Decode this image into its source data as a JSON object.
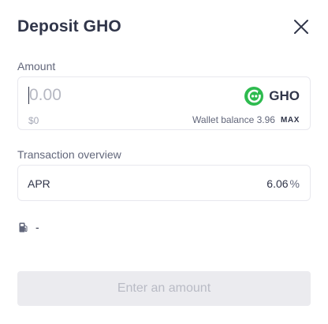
{
  "modal": {
    "title": "Deposit GHO",
    "close_icon": "close-icon"
  },
  "amount": {
    "label": "Amount",
    "placeholder": "0.00",
    "value": "",
    "usd_value": "$0",
    "token_symbol": "GHO",
    "token_icon": "gho-token-icon",
    "balance_text": "Wallet balance 3.96",
    "max_label": "MAX"
  },
  "overview": {
    "label": "Transaction overview",
    "apr_label": "APR",
    "apr_value": "6.06",
    "apr_unit": "%"
  },
  "gas": {
    "icon": "gas-pump-icon",
    "value": "-"
  },
  "submit": {
    "label": "Enter an amount"
  },
  "colors": {
    "text_primary": "#303549",
    "text_secondary": "#62677b",
    "border": "#e8e8ee",
    "gho_green": "#2ebb4f",
    "disabled_bg": "#ebebef",
    "disabled_text": "#b9bbc5"
  }
}
